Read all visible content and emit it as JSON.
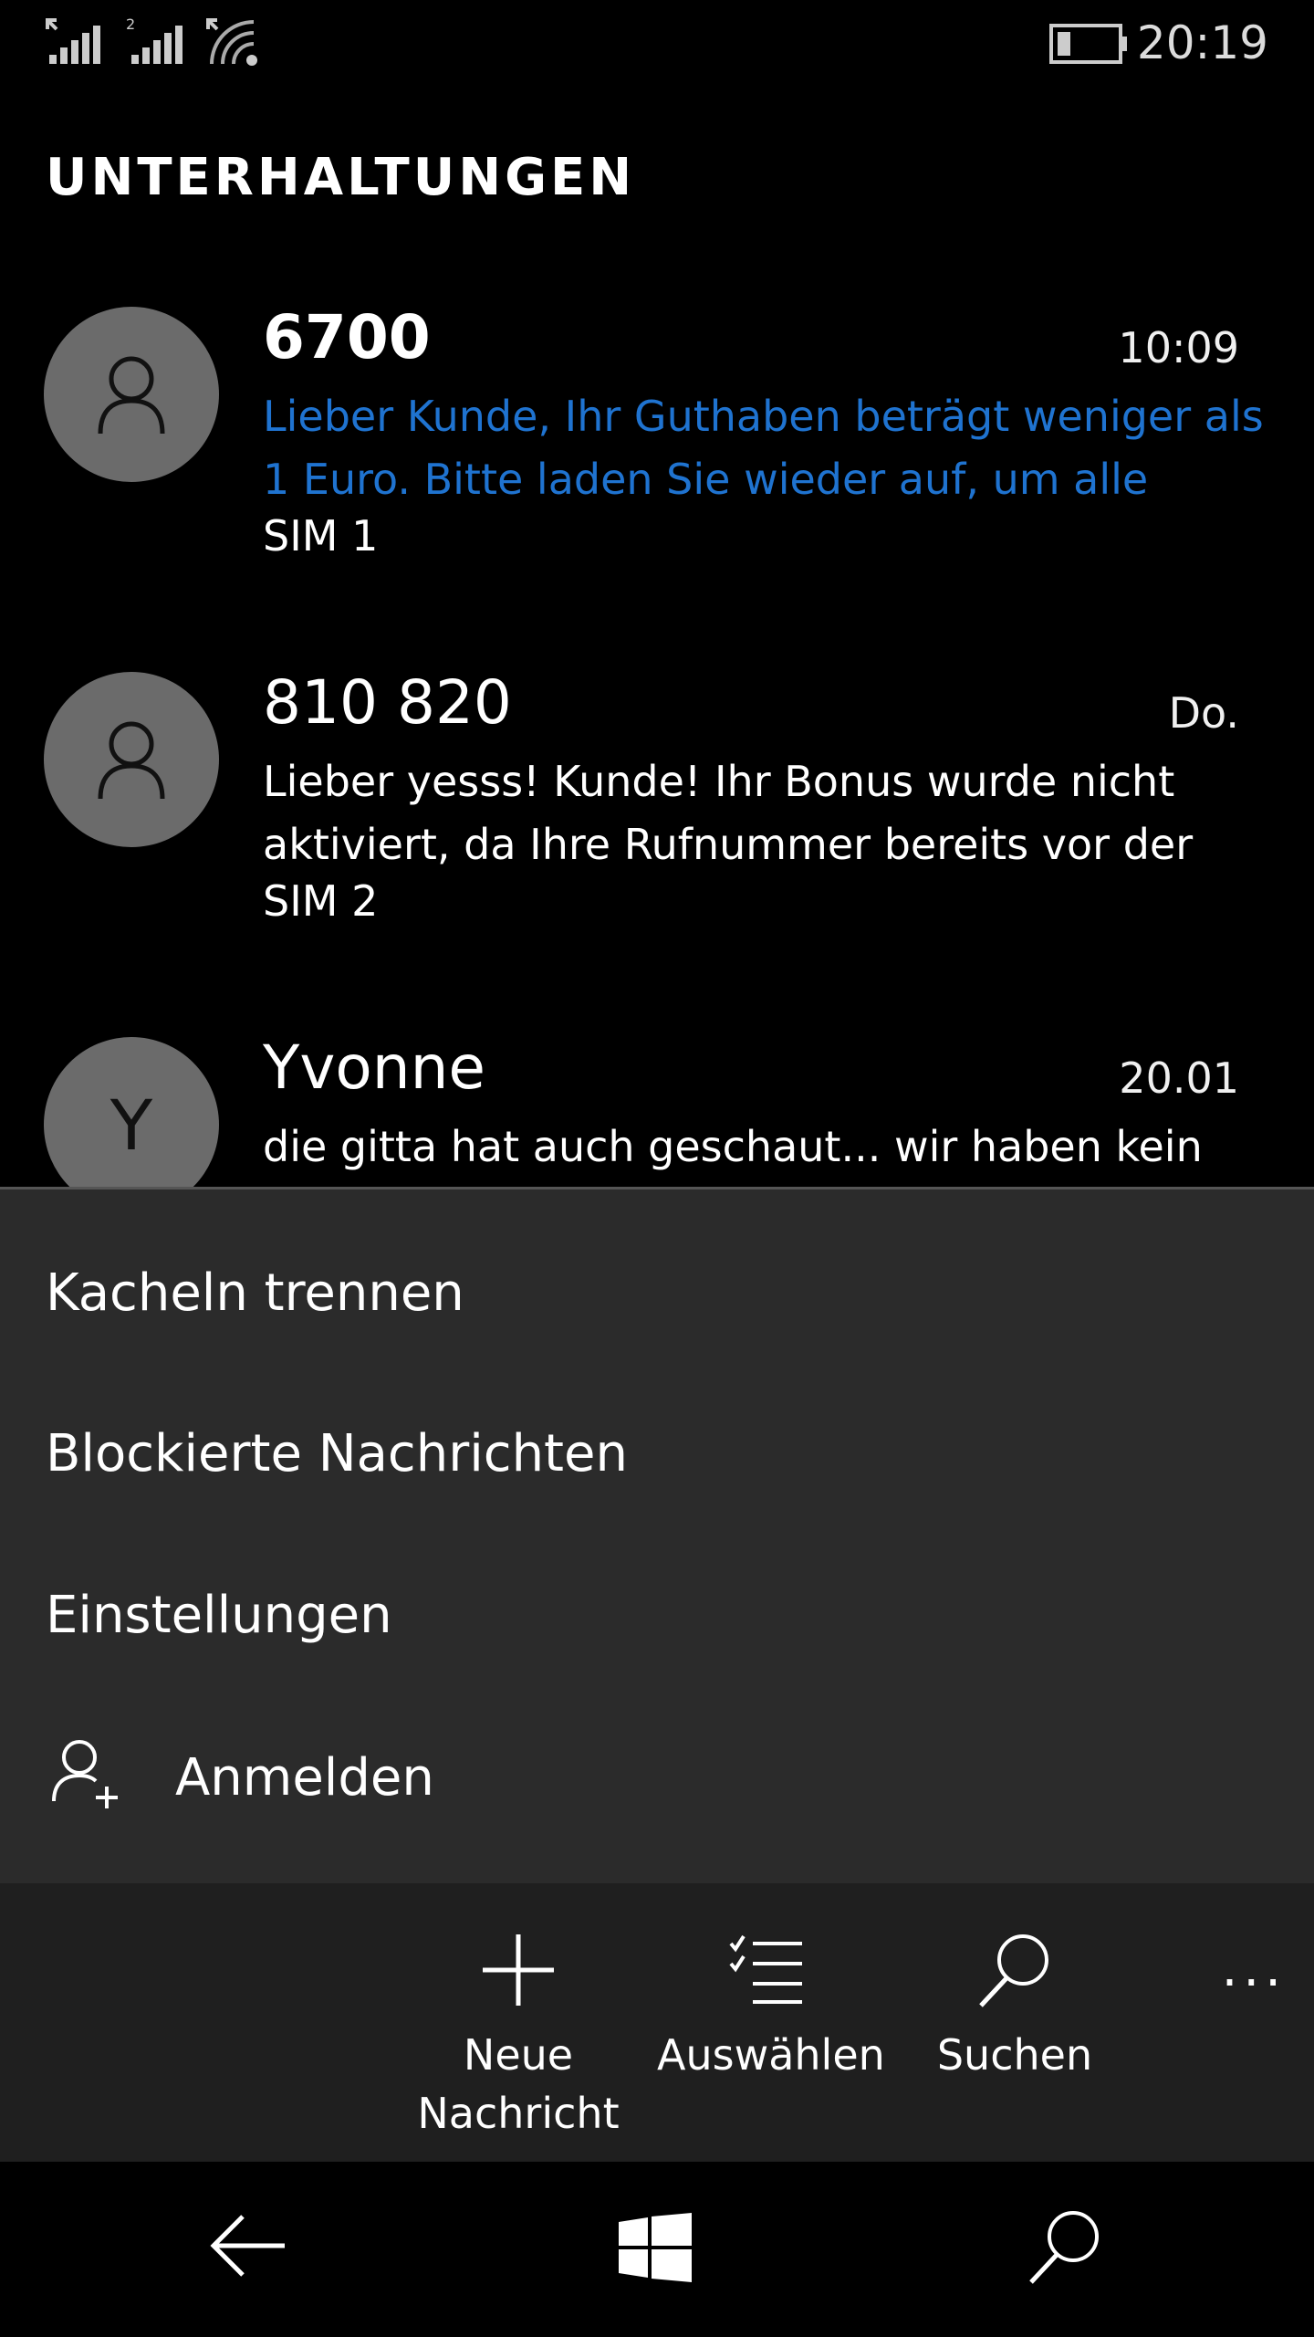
{
  "status_bar": {
    "sim1_icon": "signal-bars-icon",
    "sim2_label": "2",
    "sim2_icon": "signal-bars-icon",
    "wifi_icon": "wifi-icon",
    "battery_icon": "battery-icon",
    "time": "20:19"
  },
  "header": {
    "title": "UNTERHALTUNGEN"
  },
  "conversations": [
    {
      "name": "6700",
      "time": "10:09",
      "preview": "Lieber Kunde, Ihr Guthaben beträgt weniger als 1 Euro. Bitte laden Sie wieder auf, um alle",
      "sim": "SIM 1",
      "unread": true
    },
    {
      "name": "810 820",
      "time": "Do.",
      "preview": "Lieber yesss! Kunde! Ihr Bonus wurde nicht aktiviert, da Ihre Rufnummer bereits vor der",
      "sim": "SIM 2",
      "unread": false
    },
    {
      "name": "Yvonne",
      "initial": "Y",
      "time": "20.01",
      "preview": "die gitta hat auch geschaut... wir haben kein",
      "unread": false
    }
  ],
  "menu": {
    "items": [
      "Kacheln trennen",
      "Blockierte Nachrichten",
      "Einstellungen"
    ],
    "sign_in": "Anmelden"
  },
  "app_bar": {
    "new_message_line1": "Neue",
    "new_message_line2": "Nachricht",
    "select": "Auswählen",
    "search": "Suchen",
    "more": "···"
  },
  "colors": {
    "background": "#000000",
    "menu_background": "#2b2b2b",
    "appbar_background": "#1f1f1f",
    "accent": "#1f73d0",
    "avatar": "#6b6b6b"
  }
}
